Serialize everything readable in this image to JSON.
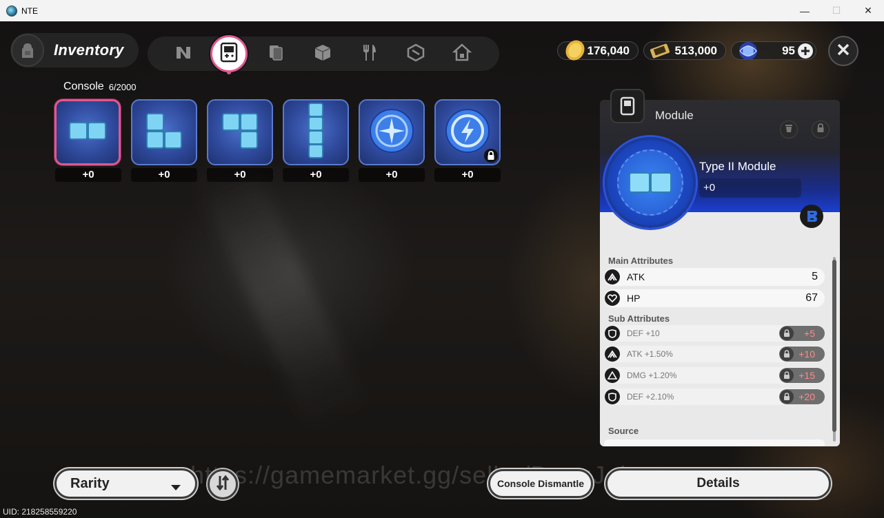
{
  "window": {
    "title": "NTE"
  },
  "header": {
    "title": "Inventory",
    "tabs": [
      {
        "icon": "n-logo-icon"
      },
      {
        "icon": "handheld-console-icon",
        "active": true
      },
      {
        "icon": "cards-icon"
      },
      {
        "icon": "box-icon"
      },
      {
        "icon": "fork-knife-icon"
      },
      {
        "icon": "cube-package-icon"
      },
      {
        "icon": "home-icon"
      }
    ],
    "currencies": [
      {
        "icon": "gold-coin-icon",
        "amount": "176,040"
      },
      {
        "icon": "ticket-icon",
        "amount": "513,000"
      },
      {
        "icon": "crystal-orb-icon",
        "amount": "95"
      }
    ]
  },
  "console": {
    "label": "Console",
    "count": "6/2000",
    "items": [
      {
        "shape": "two-block",
        "level": "+0",
        "selected": true,
        "locked": false
      },
      {
        "shape": "l-block",
        "level": "+0",
        "selected": false,
        "locked": false
      },
      {
        "shape": "j-block",
        "level": "+0",
        "selected": false,
        "locked": false
      },
      {
        "shape": "i-block",
        "level": "+0",
        "selected": false,
        "locked": false
      },
      {
        "shape": "compass-disc",
        "level": "+0",
        "selected": false,
        "locked": false
      },
      {
        "shape": "bolt-disc",
        "level": "+0",
        "selected": false,
        "locked": true
      }
    ]
  },
  "detail": {
    "category": "Module",
    "name": "Type II Module",
    "level": "+0",
    "main_title": "Main Attributes",
    "main": [
      {
        "icon": "atk-icon",
        "label": "ATK",
        "value": "5"
      },
      {
        "icon": "hp-heart-icon",
        "label": "HP",
        "value": "67"
      }
    ],
    "sub_title": "Sub Attributes",
    "sub": [
      {
        "icon": "def-shield-icon",
        "label": "DEF +10",
        "bonus": "+5"
      },
      {
        "icon": "atk-icon",
        "label": "ATK +1.50%",
        "bonus": "+10"
      },
      {
        "icon": "dmg-triangle-icon",
        "label": "DMG +1.20%",
        "bonus": "+15"
      },
      {
        "icon": "def-shield-icon",
        "label": "DEF +2.10%",
        "bonus": "+20"
      }
    ],
    "source_title": "Source"
  },
  "footer": {
    "filter_label": "Rarity",
    "dismantle_label": "Console Dismantle",
    "details_label": "Details",
    "watermark": "https://gamemarket.gg/seller/DangJohn",
    "uid": "UID: 218258559220"
  },
  "colors": {
    "accent": "#e0588f",
    "module_blue": "#1d48c2",
    "bonus_red": "#ff8a8a"
  }
}
